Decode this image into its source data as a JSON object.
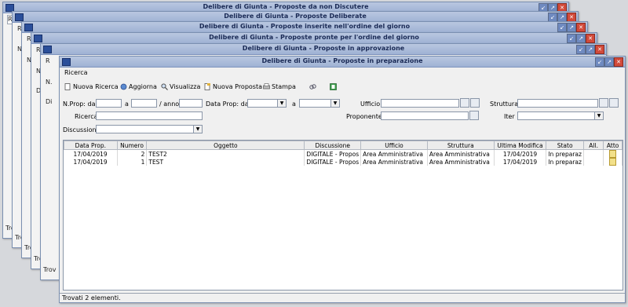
{
  "windows": [
    {
      "title": "Delibere di Giunta - Proposte da non Discutere",
      "status": "Trov"
    },
    {
      "title": "Delibere di Giunta - Proposte Deliberate",
      "status": "Trov"
    },
    {
      "title": "Delibere di Giunta - Proposte inserite nell'ordine del giorno",
      "status": "Trov"
    },
    {
      "title": "Delibere di Giunta - Proposte pronte per l'ordine del giorno",
      "status": "Trov"
    },
    {
      "title": "Delibere di Giunta - Proposte in approvazione",
      "status": "Trov"
    }
  ],
  "bg_fragments": {
    "r": "R",
    "n": "N.",
    "d": "Di"
  },
  "main": {
    "title": "Delibere di Giunta - Proposte in preparazione",
    "menu": "Ricerca",
    "toolbar": {
      "nuova_ricerca": "Nuova Ricerca",
      "aggiorna": "Aggiorna",
      "visualizza": "Visualizza",
      "nuova_proposta": "Nuova Proposta",
      "stampa": "Stampa"
    },
    "form": {
      "nprop_da": "N.Prop: da",
      "a1": "a",
      "anno": "/ anno",
      "data_prop_da": "Data Prop: da",
      "a2": "a",
      "ufficio": "Ufficio",
      "struttura": "Struttura",
      "ricerca": "Ricerca",
      "proponente": "Proponente",
      "iter": "Iter",
      "discussione": "Discussione"
    },
    "table": {
      "headers": [
        "Data Prop.",
        "Numero",
        "Oggetto",
        "Discussione",
        "Ufficio",
        "Struttura",
        "Ultima Modifica",
        "Stato",
        "All.",
        "Atto"
      ],
      "rows": [
        [
          "17/04/2019",
          "2",
          "TEST2",
          "DIGITALE - Propos",
          "Area Amministrativa",
          "Area Amministrativa",
          "17/04/2019",
          "In preparaz",
          "",
          ""
        ],
        [
          "17/04/2019",
          "1",
          "TEST",
          "DIGITALE - Propos",
          "Area Amministrativa",
          "Area Amministrativa",
          "17/04/2019",
          "In preparaz",
          "",
          ""
        ]
      ]
    },
    "status": "Trovati 2 elementi."
  },
  "colors": {
    "titlebar": "#a9bbdc",
    "close": "#d24a3a",
    "title_text": "#1a2a55"
  }
}
